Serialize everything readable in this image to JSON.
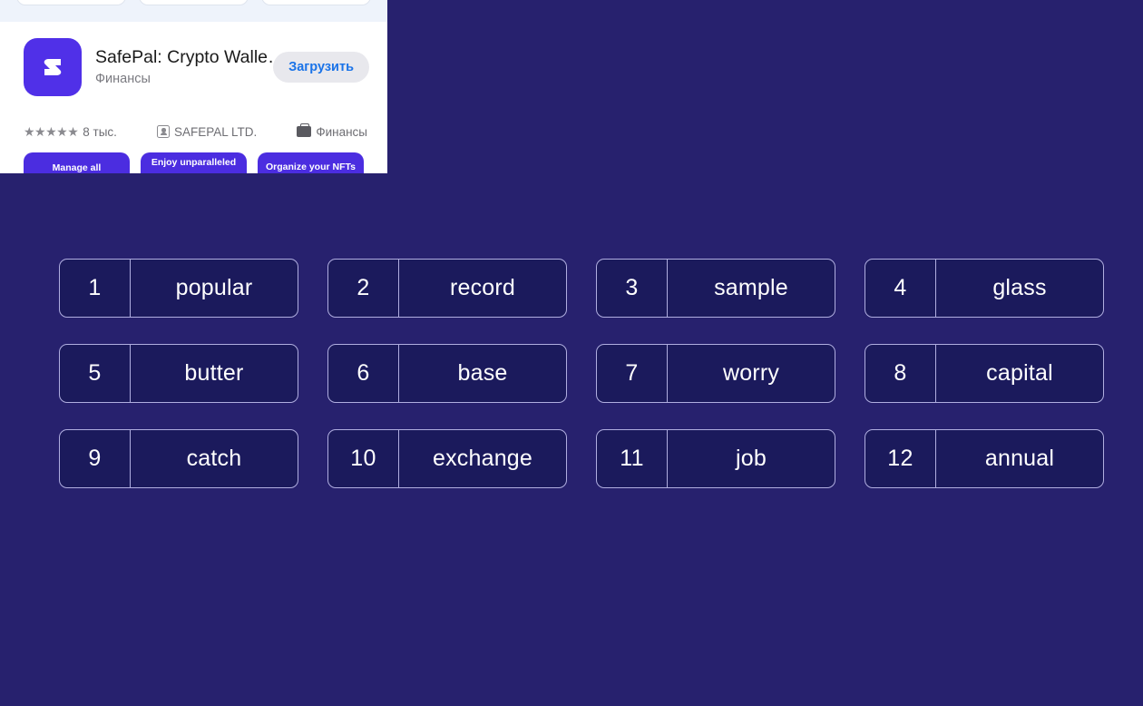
{
  "page": {
    "background_color": "#27216e",
    "tile_fill_color": "#1b1a5c",
    "tile_border_color": "#b0aee0"
  },
  "seed_grid": {
    "columns": 4,
    "rows": 3,
    "tiles": [
      {
        "index": "1",
        "word": "popular"
      },
      {
        "index": "2",
        "word": "record"
      },
      {
        "index": "3",
        "word": "sample"
      },
      {
        "index": "4",
        "word": "glass"
      },
      {
        "index": "5",
        "word": "butter"
      },
      {
        "index": "6",
        "word": "base"
      },
      {
        "index": "7",
        "word": "worry"
      },
      {
        "index": "8",
        "word": "capital"
      },
      {
        "index": "9",
        "word": "catch"
      },
      {
        "index": "10",
        "word": "exchange"
      },
      {
        "index": "11",
        "word": "job"
      },
      {
        "index": "12",
        "word": "annual"
      }
    ]
  },
  "app_overlay": {
    "icon_name": "safepal-app-icon",
    "icon_color": "#5030e8",
    "title": "SafePal: Crypto Walle…",
    "category": "Финансы",
    "download_button": "Загрузить",
    "download_button_color": "#1a73e8",
    "rating_stars": "★★★★★",
    "rating_count": "8 тыс.",
    "developer": "SAFEPAL LTD.",
    "developer_icon": "id-badge-icon",
    "category_icon": "briefcase-icon",
    "category_secondary": "Финансы",
    "promo_cards": [
      {
        "text": "Manage all"
      },
      {
        "text": "Enjoy unparalleled"
      },
      {
        "text": "Organize your NFTs"
      }
    ],
    "screenshot_thumbs": [
      {
        "label": ""
      },
      {
        "label": ""
      },
      {
        "label": ""
      }
    ]
  }
}
